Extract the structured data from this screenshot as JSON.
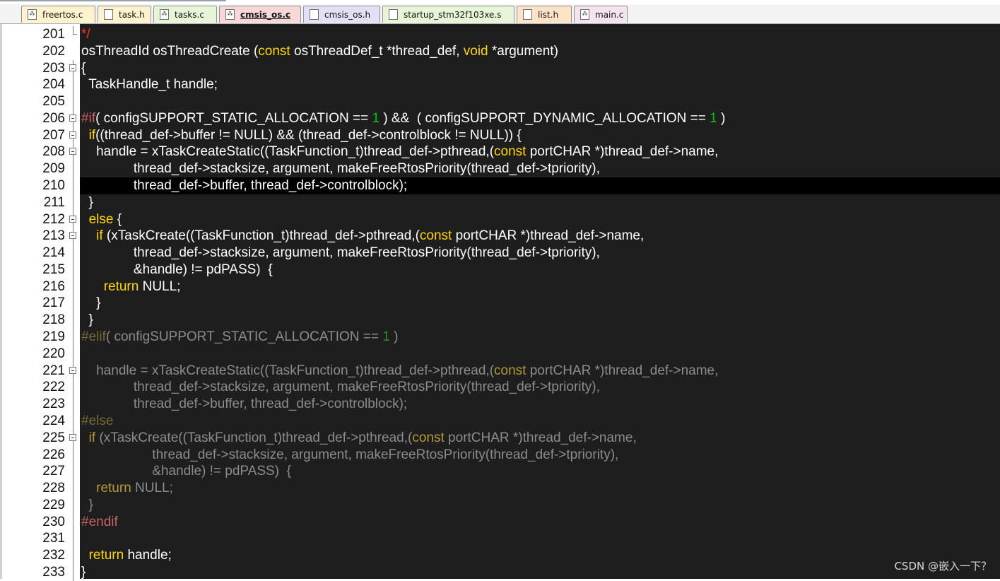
{
  "tabs": [
    {
      "label": "freertos.c",
      "kind": "c",
      "color": "#fff2cc"
    },
    {
      "label": "task.h",
      "kind": "h",
      "color": "#fff2cc"
    },
    {
      "label": "tasks.c",
      "kind": "c",
      "color": "#e5f5d6"
    },
    {
      "label": "cmsis_os.c",
      "kind": "c",
      "color": "#f8d7d7",
      "active": true
    },
    {
      "label": "cmsis_os.h",
      "kind": "h",
      "color": "#e3e0f5"
    },
    {
      "label": "startup_stm32f103xe.s",
      "kind": "s",
      "color": "#e5f5d6"
    },
    {
      "label": "list.h",
      "kind": "h",
      "color": "#ffe3c7"
    },
    {
      "label": "main.c",
      "kind": "c",
      "color": "#f6e3f0"
    }
  ],
  "editor": {
    "highlighted_line": 210,
    "lines": [
      {
        "n": "201",
        "fold": "corner",
        "tokens": [
          [
            "cm",
            "*/"
          ]
        ]
      },
      {
        "n": "202",
        "fold": "",
        "tokens": [
          [
            "",
            "osThreadId osThreadCreate ("
          ],
          [
            "kw",
            "const"
          ],
          [
            "",
            " osThreadDef_t *thread_def, "
          ],
          [
            "kw",
            "void"
          ],
          [
            "",
            " *argument)"
          ]
        ]
      },
      {
        "n": "203",
        "fold": "box",
        "tokens": [
          [
            "",
            "{"
          ]
        ]
      },
      {
        "n": "204",
        "fold": "line",
        "tokens": [
          [
            "",
            "  TaskHandle_t handle;"
          ]
        ]
      },
      {
        "n": "205",
        "fold": "line",
        "tokens": [
          [
            "",
            ""
          ]
        ]
      },
      {
        "n": "206",
        "fold": "box",
        "tokens": [
          [
            "pp",
            "#if"
          ],
          [
            "",
            "( configSUPPORT_STATIC_ALLOCATION == "
          ],
          [
            "num",
            "1"
          ],
          [
            "",
            " ) &&  ( configSUPPORT_DYNAMIC_ALLOCATION == "
          ],
          [
            "num",
            "1"
          ],
          [
            "",
            " )"
          ]
        ]
      },
      {
        "n": "207",
        "fold": "box",
        "tokens": [
          [
            "",
            "  "
          ],
          [
            "kw",
            "if"
          ],
          [
            "",
            "((thread_def->buffer != NULL) && (thread_def->controlblock != NULL)) {"
          ]
        ]
      },
      {
        "n": "208",
        "fold": "box",
        "tokens": [
          [
            "",
            "    handle = xTaskCreateStatic((TaskFunction_t)thread_def->pthread,("
          ],
          [
            "kw",
            "const"
          ],
          [
            "",
            " portCHAR *)thread_def->name,"
          ]
        ]
      },
      {
        "n": "209",
        "fold": "line",
        "tokens": [
          [
            "",
            "              thread_def->stacksize, argument, makeFreeRtosPriority(thread_def->tpriority),"
          ]
        ]
      },
      {
        "n": "210",
        "fold": "line",
        "tokens": [
          [
            "",
            "              thread_def->buffer, thread_def->controlblock);"
          ]
        ]
      },
      {
        "n": "211",
        "fold": "line",
        "tokens": [
          [
            "",
            "  }"
          ]
        ]
      },
      {
        "n": "212",
        "fold": "box",
        "tokens": [
          [
            "",
            "  "
          ],
          [
            "kw",
            "else"
          ],
          [
            "",
            " {"
          ]
        ]
      },
      {
        "n": "213",
        "fold": "box",
        "tokens": [
          [
            "",
            "    "
          ],
          [
            "kw",
            "if"
          ],
          [
            "",
            " (xTaskCreate((TaskFunction_t)thread_def->pthread,("
          ],
          [
            "kw",
            "const"
          ],
          [
            "",
            " portCHAR *)thread_def->name,"
          ]
        ]
      },
      {
        "n": "214",
        "fold": "line",
        "tokens": [
          [
            "",
            "              thread_def->stacksize, argument, makeFreeRtosPriority(thread_def->tpriority),"
          ]
        ]
      },
      {
        "n": "215",
        "fold": "line",
        "tokens": [
          [
            "",
            "              &handle) != pdPASS)  {"
          ]
        ]
      },
      {
        "n": "216",
        "fold": "line",
        "tokens": [
          [
            "",
            "      "
          ],
          [
            "kw",
            "return"
          ],
          [
            "",
            " NULL;"
          ]
        ]
      },
      {
        "n": "217",
        "fold": "line",
        "tokens": [
          [
            "",
            "    }"
          ]
        ]
      },
      {
        "n": "218",
        "fold": "line",
        "tokens": [
          [
            "",
            "  }"
          ]
        ]
      },
      {
        "n": "219",
        "fold": "line",
        "tokens": [
          [
            "dimpp",
            "#elif"
          ],
          [
            "dim",
            "( configSUPPORT_STATIC_ALLOCATION == "
          ],
          [
            "dimnum",
            "1"
          ],
          [
            "dim",
            " )"
          ]
        ]
      },
      {
        "n": "220",
        "fold": "line",
        "tokens": [
          [
            "",
            ""
          ]
        ]
      },
      {
        "n": "221",
        "fold": "box",
        "tokens": [
          [
            "dim",
            "    handle = xTaskCreateStatic((TaskFunction_t)thread_def->pthread,("
          ],
          [
            "dimkw",
            "const"
          ],
          [
            "dim",
            " portCHAR *)thread_def->name,"
          ]
        ]
      },
      {
        "n": "222",
        "fold": "line",
        "tokens": [
          [
            "dim",
            "              thread_def->stacksize, argument, makeFreeRtosPriority(thread_def->tpriority),"
          ]
        ]
      },
      {
        "n": "223",
        "fold": "line",
        "tokens": [
          [
            "dim",
            "              thread_def->buffer, thread_def->controlblock);"
          ]
        ]
      },
      {
        "n": "224",
        "fold": "line",
        "tokens": [
          [
            "dimpp",
            "#else"
          ]
        ]
      },
      {
        "n": "225",
        "fold": "box",
        "tokens": [
          [
            "dim",
            "  "
          ],
          [
            "dimkw",
            "if"
          ],
          [
            "dim",
            " (xTaskCreate((TaskFunction_t)thread_def->pthread,("
          ],
          [
            "dimkw",
            "const"
          ],
          [
            "dim",
            " portCHAR *)thread_def->name,"
          ]
        ]
      },
      {
        "n": "226",
        "fold": "line",
        "tokens": [
          [
            "dim",
            "                   thread_def->stacksize, argument, makeFreeRtosPriority(thread_def->tpriority),"
          ]
        ]
      },
      {
        "n": "227",
        "fold": "line",
        "tokens": [
          [
            "dim",
            "                   &handle) != pdPASS)  {"
          ]
        ]
      },
      {
        "n": "228",
        "fold": "line",
        "tokens": [
          [
            "dim",
            "    "
          ],
          [
            "dimkw",
            "return"
          ],
          [
            "dim",
            " NULL;"
          ]
        ]
      },
      {
        "n": "229",
        "fold": "line",
        "tokens": [
          [
            "dim",
            "  }"
          ]
        ]
      },
      {
        "n": "230",
        "fold": "line",
        "tokens": [
          [
            "pp",
            "#endif"
          ]
        ]
      },
      {
        "n": "231",
        "fold": "line",
        "tokens": [
          [
            "",
            ""
          ]
        ]
      },
      {
        "n": "232",
        "fold": "line",
        "tokens": [
          [
            "",
            "  "
          ],
          [
            "kw",
            "return"
          ],
          [
            "",
            " handle;"
          ]
        ]
      },
      {
        "n": "233",
        "fold": "line",
        "tokens": [
          [
            "",
            "}"
          ]
        ]
      }
    ]
  },
  "watermark": "CSDN @嵌入一下？"
}
